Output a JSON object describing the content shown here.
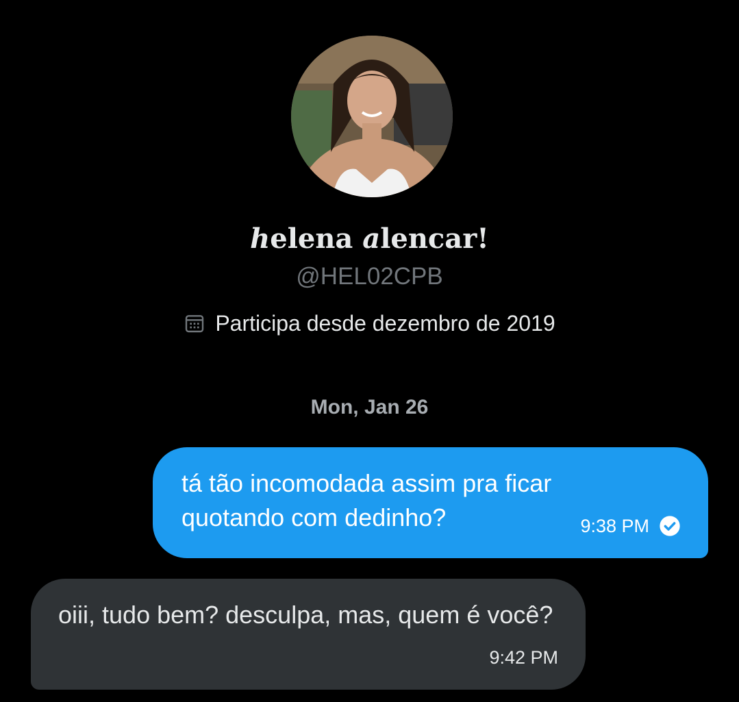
{
  "profile": {
    "display_name_a": "h",
    "display_name_b": "elena ",
    "display_name_c": "a",
    "display_name_d": "lencar!",
    "handle": "@HEL02CPB",
    "joined_text": "Participa desde dezembro de 2019",
    "joined_icon": "calendar-icon"
  },
  "conversation": {
    "date_separator": "Mon, Jan 26",
    "messages": [
      {
        "direction": "sent",
        "text": "tá tão incomodada assim pra ficar quotando com dedinho?",
        "time": "9:38 PM",
        "status_icon": "read-check-icon"
      },
      {
        "direction": "received",
        "text": "oiii, tudo bem? desculpa, mas, quem é você?",
        "time": "9:42 PM"
      }
    ]
  },
  "colors": {
    "background": "#000000",
    "sent_bubble": "#1d9bf0",
    "received_bubble": "#2f3336",
    "secondary_text": "#71767b"
  }
}
